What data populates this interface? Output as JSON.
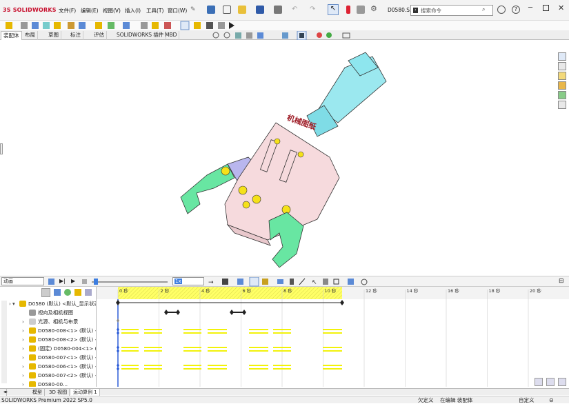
{
  "app": {
    "logo": "SOLIDWORKS",
    "doc_title": "D0580.S..."
  },
  "menu": [
    {
      "label": "文件(F)"
    },
    {
      "label": "编辑(E)"
    },
    {
      "label": "视图(V)"
    },
    {
      "label": "插入(I)"
    },
    {
      "label": "工具(T)"
    },
    {
      "label": "窗口(W)"
    }
  ],
  "search": {
    "placeholder": "搜索命令"
  },
  "tabs": [
    "装配体",
    "布局",
    "草图",
    "标注",
    "评估",
    "SOLIDWORKS 插件",
    "MBD"
  ],
  "model": {
    "stamp_text": "机械图纸"
  },
  "motion": {
    "study_type": "动画",
    "speed": "1x"
  },
  "timeline": {
    "ticks": [
      "0 秒",
      "2 秒",
      "4 秒",
      "6 秒",
      "8 秒",
      "10 秒",
      "12 秒",
      "14 秒",
      "16 秒",
      "18 秒",
      "20 秒"
    ]
  },
  "tree": [
    {
      "label": "D0580 (默认) <默认_显示状态"
    },
    {
      "label": "视向及相机视图"
    },
    {
      "label": "光源、相机与布景"
    },
    {
      "label": "D0580-008<1> (默认) <-"
    },
    {
      "label": "D0580-008<2> (默认) <-"
    },
    {
      "label": "(固定) D0580-004<1> (默"
    },
    {
      "label": "D0580-007<1> (默认) <-"
    },
    {
      "label": "D0580-006<1> (默认) <-"
    },
    {
      "label": "D0580-007<2> (默认) <-"
    },
    {
      "label": "D0580-00..."
    }
  ],
  "bottom_tabs": [
    "模型",
    "3D 视图",
    "运动算例 1"
  ],
  "status": {
    "product": "SOLIDWORKS Premium 2022 SP5.0",
    "under_defined": "欠定义",
    "editing": "在编辑 装配体",
    "custom": "自定义"
  },
  "colors": {
    "accent": "#c8102e",
    "timeline_stripe": "#ffff66",
    "keyframe_bar": "#f2f20a",
    "gripper_green": "#66e6a0",
    "body_pink": "#f5d6dc",
    "cylinder_cyan": "#8ee6ee"
  }
}
